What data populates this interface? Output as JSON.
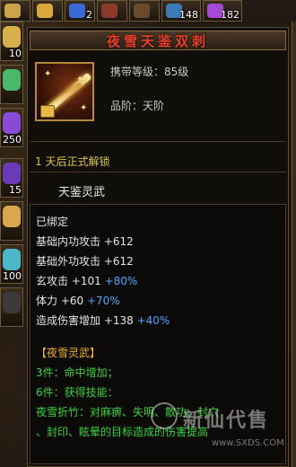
{
  "inventory_top": {
    "slots": [
      {
        "count": "",
        "icon": "scroll-icon",
        "color": "#c9a24a"
      },
      {
        "count": "",
        "icon": "coin-icon",
        "color": "#d8a83a"
      },
      {
        "count": "2",
        "icon": "gem-icon",
        "color": "#3a6ad8"
      },
      {
        "count": "",
        "icon": "orb-icon",
        "color": "#8a3a2a"
      },
      {
        "count": "",
        "icon": "bag-icon",
        "color": "#6a4a2a"
      },
      {
        "count": "148",
        "icon": "potion-icon",
        "color": "#3a7ab8"
      },
      {
        "count": "182",
        "icon": "potion-icon",
        "color": "#a84ad8"
      }
    ]
  },
  "inventory_left": {
    "slots": [
      {
        "count": "10",
        "icon": "token-icon",
        "color": "#d8b04a"
      },
      {
        "count": "",
        "icon": "leaf-icon",
        "color": "#4ab86a"
      },
      {
        "count": "250",
        "icon": "crystal-icon",
        "color": "#8a4ad8"
      },
      {
        "count": "15",
        "icon": "crystal-icon",
        "color": "#6a3ab8"
      },
      {
        "count": "",
        "icon": "lantern-icon",
        "color": "#d8a84a"
      },
      {
        "count": "100",
        "icon": "bead-icon",
        "color": "#4ab8c8"
      },
      {
        "count": "",
        "icon": "shard-icon",
        "color": "#3a3a3a"
      }
    ]
  },
  "item": {
    "name": "夜雪天鉴双刺",
    "carry_level": "携带等级：85级",
    "grade": "品阶：天阶",
    "unlock_line": "1 天后正式解锁",
    "subtitle": "天鉴灵武"
  },
  "stats": {
    "bound": "已绑定",
    "lines": [
      {
        "text": "基础内功攻击 +612",
        "bonus": ""
      },
      {
        "text": "基础外功攻击 +612",
        "bonus": ""
      },
      {
        "text": "玄攻击 +101",
        "bonus": "+80%"
      },
      {
        "text": "体力 +60",
        "bonus": "+70%"
      },
      {
        "text": "造成伤害增加 +138",
        "bonus": "+40%"
      }
    ],
    "set_name": "【夜雪灵武】",
    "set_3": "3件：命中增加；",
    "set_6": "6件：获得技能：",
    "skill_1": "夜雪折竹：对麻痹、失明、散功、封穴",
    "skill_2": "、封印、眩晕的目标造成的伤害提高"
  },
  "watermark": {
    "text": "新仙代售",
    "url": "www.SXDS.COM"
  }
}
